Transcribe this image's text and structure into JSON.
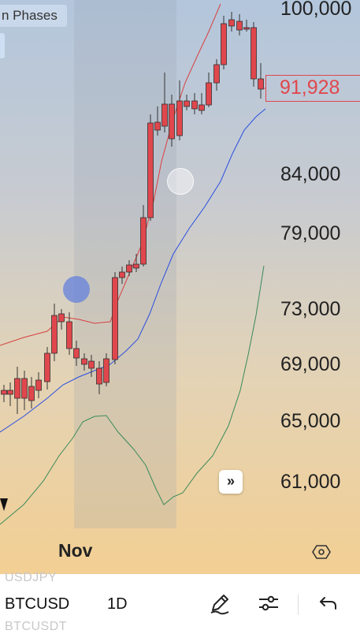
{
  "indicator": {
    "label": "n Phases"
  },
  "price_axis": {
    "labels": [
      "100,000",
      "84,000",
      "79,000",
      "73,000",
      "69,000",
      "65,000",
      "61,000"
    ],
    "current_price": "91,928"
  },
  "time_axis": {
    "label": "Nov"
  },
  "toolbar": {
    "ghost_above": "USDJPY",
    "symbol": "BTCUSD",
    "interval": "1D",
    "ghost_below": "BTCUSDT",
    "icons": [
      "draw-pen-icon",
      "settings-sliders-icon",
      "undo-icon"
    ]
  },
  "colors": {
    "up": "#8fd98f",
    "down": "#e0474d",
    "upper_band": "#d94040",
    "middle_band": "#2b4ee0",
    "lower_band": "#3a8a5a"
  }
}
